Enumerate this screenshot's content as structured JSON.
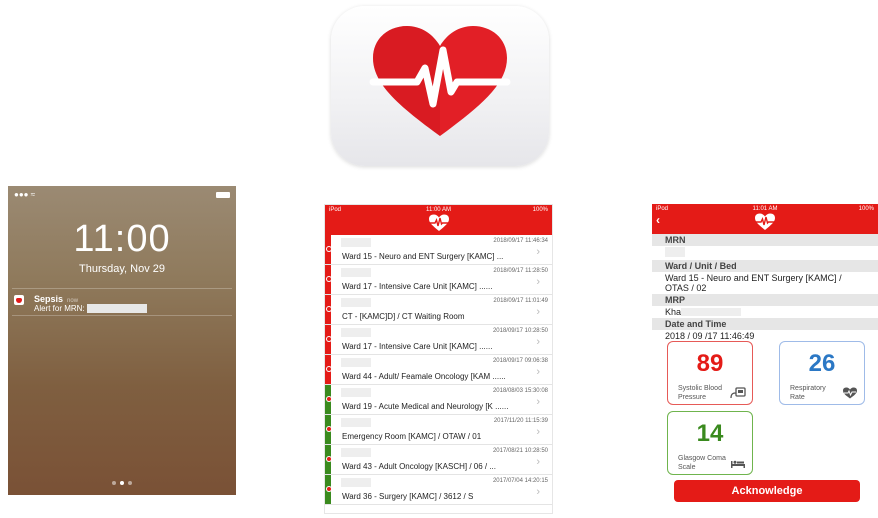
{
  "colors": {
    "brand_red": "#e41b17",
    "green": "#3a8a1e",
    "blue": "#2b78c5",
    "card_red_border": "#e65a57",
    "card_blue_border": "#9fbbe8",
    "card_green_border": "#6fb44d"
  },
  "lock_screen": {
    "time": "11:00",
    "date": "Thursday, Nov 29",
    "notification": {
      "title": "Sepsis",
      "time_ago": "now",
      "body": "Alert for MRN:"
    }
  },
  "status_bar": {
    "carrier": "iPod",
    "time": "11:00 AM",
    "battery": "100%"
  },
  "detail_status_bar": {
    "carrier": "iPod",
    "time": "11:01 AM",
    "battery": "100%"
  },
  "list": {
    "rows": [
      {
        "ts": "2018/09/17  11:46:34",
        "ward": "Ward 15 - Neuro and ENT Surgery [KAMC]  ...",
        "flag": "red"
      },
      {
        "ts": "2018/09/17 11:28:50",
        "ward": "Ward 17 - Intensive Care Unit [KAMC]  ......",
        "flag": "red"
      },
      {
        "ts": "2018/09/17 11:01:49",
        "ward": "CT - [KAMC]D] / CT Waiting Room",
        "flag": "red"
      },
      {
        "ts": "2018/09/17 10:28:50",
        "ward": "Ward 17 - Intensive Care Unit [KAMC]  ......",
        "flag": "red"
      },
      {
        "ts": "2018/09/17 09:06:38",
        "ward": "Ward 44 - Adult/ Feamale Oncology [KAM  ......",
        "flag": "red"
      },
      {
        "ts": "2018/08/03 15:30:08",
        "ward": "Ward 19 - Acute Medical and Neurology [K ......",
        "flag": "green"
      },
      {
        "ts": "2017/11/20 11:15:39",
        "ward": "Emergency Room [KAMC] / OTAW / 01",
        "flag": "green"
      },
      {
        "ts": "2017/08/21 10:28:50",
        "ward": "Ward 43 - Adult Oncology [KASCH]  / 06 / ...",
        "flag": "green"
      },
      {
        "ts": "2017/07/04 14:20:15",
        "ward": "Ward 36 - Surgery [KAMC] / 3612 / S",
        "flag": "green"
      }
    ]
  },
  "detail": {
    "mrn_label": "MRN",
    "ward_label": "Ward / Unit / Bed",
    "ward_value_1": "Ward 15 - Neuro and ENT Surgery [KAMC] /",
    "ward_value_2": "OTAS / 02",
    "mrp_label": "MRP",
    "mrp_value": "Kha",
    "datetime_label": "Date and Time",
    "datetime_value": "2018 / 09 /17 11:46:49",
    "cards": {
      "sbp": {
        "value": "89",
        "label_1": "Systolic Blood",
        "label_2": "Pressure",
        "icon": "blood-pressure-icon"
      },
      "rr": {
        "value": "26",
        "label_1": "Respiratory",
        "label_2": "Rate",
        "icon": "heart-rate-icon"
      },
      "gcs": {
        "value": "14",
        "label_1": "Glasgow Coma",
        "label_2": "Scale",
        "icon": "bed-icon"
      }
    },
    "acknowledge_label": "Acknowledge"
  }
}
